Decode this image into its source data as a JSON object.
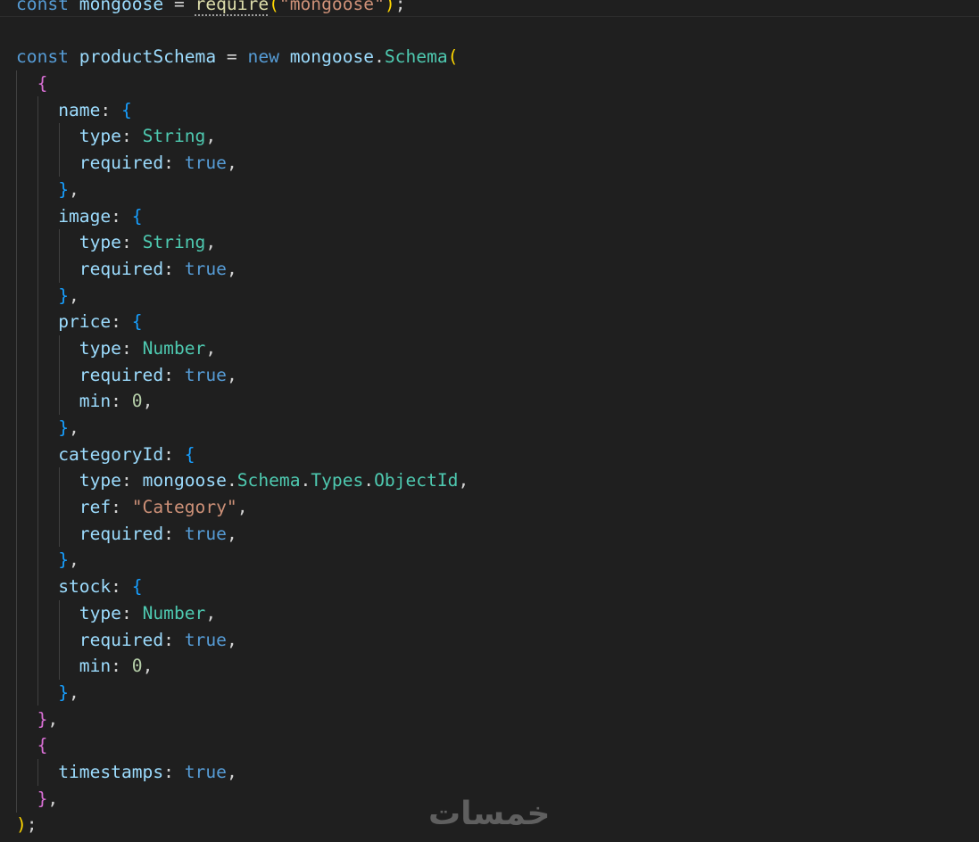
{
  "editor": {
    "lines": [
      [
        {
          "c": "kw",
          "t": "const"
        },
        {
          "c": "punc",
          "t": " "
        },
        {
          "c": "var",
          "t": "mongoose"
        },
        {
          "c": "punc",
          "t": " = "
        },
        {
          "c": "fn dotted",
          "t": "require"
        },
        {
          "c": "b1",
          "t": "("
        },
        {
          "c": "str",
          "t": "\"mongoose\""
        },
        {
          "c": "b1",
          "t": ")"
        },
        {
          "c": "punc",
          "t": ";"
        }
      ],
      [],
      [
        {
          "c": "kw",
          "t": "const"
        },
        {
          "c": "punc",
          "t": " "
        },
        {
          "c": "var",
          "t": "productSchema"
        },
        {
          "c": "punc",
          "t": " = "
        },
        {
          "c": "kw",
          "t": "new"
        },
        {
          "c": "punc",
          "t": " "
        },
        {
          "c": "var",
          "t": "mongoose"
        },
        {
          "c": "punc",
          "t": "."
        },
        {
          "c": "cls",
          "t": "Schema"
        },
        {
          "c": "b1",
          "t": "("
        }
      ],
      [
        {
          "c": "punc",
          "t": "  "
        },
        {
          "c": "b2",
          "t": "{"
        }
      ],
      [
        {
          "c": "punc",
          "t": "    "
        },
        {
          "c": "prop",
          "t": "name"
        },
        {
          "c": "punc",
          "t": ": "
        },
        {
          "c": "b3",
          "t": "{"
        }
      ],
      [
        {
          "c": "punc",
          "t": "      "
        },
        {
          "c": "prop",
          "t": "type"
        },
        {
          "c": "punc",
          "t": ": "
        },
        {
          "c": "cls",
          "t": "String"
        },
        {
          "c": "punc",
          "t": ","
        }
      ],
      [
        {
          "c": "punc",
          "t": "      "
        },
        {
          "c": "prop",
          "t": "required"
        },
        {
          "c": "punc",
          "t": ": "
        },
        {
          "c": "kw",
          "t": "true"
        },
        {
          "c": "punc",
          "t": ","
        }
      ],
      [
        {
          "c": "punc",
          "t": "    "
        },
        {
          "c": "b3",
          "t": "}"
        },
        {
          "c": "punc",
          "t": ","
        }
      ],
      [
        {
          "c": "punc",
          "t": "    "
        },
        {
          "c": "prop",
          "t": "image"
        },
        {
          "c": "punc",
          "t": ": "
        },
        {
          "c": "b3",
          "t": "{"
        }
      ],
      [
        {
          "c": "punc",
          "t": "      "
        },
        {
          "c": "prop",
          "t": "type"
        },
        {
          "c": "punc",
          "t": ": "
        },
        {
          "c": "cls",
          "t": "String"
        },
        {
          "c": "punc",
          "t": ","
        }
      ],
      [
        {
          "c": "punc",
          "t": "      "
        },
        {
          "c": "prop",
          "t": "required"
        },
        {
          "c": "punc",
          "t": ": "
        },
        {
          "c": "kw",
          "t": "true"
        },
        {
          "c": "punc",
          "t": ","
        }
      ],
      [
        {
          "c": "punc",
          "t": "    "
        },
        {
          "c": "b3",
          "t": "}"
        },
        {
          "c": "punc",
          "t": ","
        }
      ],
      [
        {
          "c": "punc",
          "t": "    "
        },
        {
          "c": "prop",
          "t": "price"
        },
        {
          "c": "punc",
          "t": ": "
        },
        {
          "c": "b3",
          "t": "{"
        }
      ],
      [
        {
          "c": "punc",
          "t": "      "
        },
        {
          "c": "prop",
          "t": "type"
        },
        {
          "c": "punc",
          "t": ": "
        },
        {
          "c": "cls",
          "t": "Number"
        },
        {
          "c": "punc",
          "t": ","
        }
      ],
      [
        {
          "c": "punc",
          "t": "      "
        },
        {
          "c": "prop",
          "t": "required"
        },
        {
          "c": "punc",
          "t": ": "
        },
        {
          "c": "kw",
          "t": "true"
        },
        {
          "c": "punc",
          "t": ","
        }
      ],
      [
        {
          "c": "punc",
          "t": "      "
        },
        {
          "c": "prop",
          "t": "min"
        },
        {
          "c": "punc",
          "t": ": "
        },
        {
          "c": "num",
          "t": "0"
        },
        {
          "c": "punc",
          "t": ","
        }
      ],
      [
        {
          "c": "punc",
          "t": "    "
        },
        {
          "c": "b3",
          "t": "}"
        },
        {
          "c": "punc",
          "t": ","
        }
      ],
      [
        {
          "c": "punc",
          "t": "    "
        },
        {
          "c": "prop",
          "t": "categoryId"
        },
        {
          "c": "punc",
          "t": ": "
        },
        {
          "c": "b3",
          "t": "{"
        }
      ],
      [
        {
          "c": "punc",
          "t": "      "
        },
        {
          "c": "prop",
          "t": "type"
        },
        {
          "c": "punc",
          "t": ": "
        },
        {
          "c": "var",
          "t": "mongoose"
        },
        {
          "c": "punc",
          "t": "."
        },
        {
          "c": "cls",
          "t": "Schema"
        },
        {
          "c": "punc",
          "t": "."
        },
        {
          "c": "cls",
          "t": "Types"
        },
        {
          "c": "punc",
          "t": "."
        },
        {
          "c": "cls",
          "t": "ObjectId"
        },
        {
          "c": "punc",
          "t": ","
        }
      ],
      [
        {
          "c": "punc",
          "t": "      "
        },
        {
          "c": "prop",
          "t": "ref"
        },
        {
          "c": "punc",
          "t": ": "
        },
        {
          "c": "str",
          "t": "\"Category\""
        },
        {
          "c": "punc",
          "t": ","
        }
      ],
      [
        {
          "c": "punc",
          "t": "      "
        },
        {
          "c": "prop",
          "t": "required"
        },
        {
          "c": "punc",
          "t": ": "
        },
        {
          "c": "kw",
          "t": "true"
        },
        {
          "c": "punc",
          "t": ","
        }
      ],
      [
        {
          "c": "punc",
          "t": "    "
        },
        {
          "c": "b3",
          "t": "}"
        },
        {
          "c": "punc",
          "t": ","
        }
      ],
      [
        {
          "c": "punc",
          "t": "    "
        },
        {
          "c": "prop",
          "t": "stock"
        },
        {
          "c": "punc",
          "t": ": "
        },
        {
          "c": "b3",
          "t": "{"
        }
      ],
      [
        {
          "c": "punc",
          "t": "      "
        },
        {
          "c": "prop",
          "t": "type"
        },
        {
          "c": "punc",
          "t": ": "
        },
        {
          "c": "cls",
          "t": "Number"
        },
        {
          "c": "punc",
          "t": ","
        }
      ],
      [
        {
          "c": "punc",
          "t": "      "
        },
        {
          "c": "prop",
          "t": "required"
        },
        {
          "c": "punc",
          "t": ": "
        },
        {
          "c": "kw",
          "t": "true"
        },
        {
          "c": "punc",
          "t": ","
        }
      ],
      [
        {
          "c": "punc",
          "t": "      "
        },
        {
          "c": "prop",
          "t": "min"
        },
        {
          "c": "punc",
          "t": ": "
        },
        {
          "c": "num",
          "t": "0"
        },
        {
          "c": "punc",
          "t": ","
        }
      ],
      [
        {
          "c": "punc",
          "t": "    "
        },
        {
          "c": "b3",
          "t": "}"
        },
        {
          "c": "punc",
          "t": ","
        }
      ],
      [
        {
          "c": "punc",
          "t": "  "
        },
        {
          "c": "b2",
          "t": "}"
        },
        {
          "c": "punc",
          "t": ","
        }
      ],
      [
        {
          "c": "punc",
          "t": "  "
        },
        {
          "c": "b2",
          "t": "{"
        }
      ],
      [
        {
          "c": "punc",
          "t": "    "
        },
        {
          "c": "prop",
          "t": "timestamps"
        },
        {
          "c": "punc",
          "t": ": "
        },
        {
          "c": "kw",
          "t": "true"
        },
        {
          "c": "punc",
          "t": ","
        }
      ],
      [
        {
          "c": "punc",
          "t": "  "
        },
        {
          "c": "b2",
          "t": "}"
        },
        {
          "c": "punc",
          "t": ","
        }
      ],
      [
        {
          "c": "b1",
          "t": ")"
        },
        {
          "c": "punc",
          "t": ";"
        }
      ]
    ]
  },
  "watermark": {
    "text": "خمسات"
  },
  "colors": {
    "background": "#1f1f1f",
    "keyword": "#569cd6",
    "variable": "#9cdcfe",
    "function": "#dcdcaa",
    "class": "#4ec9b0",
    "string": "#ce9178",
    "number": "#b5cea8",
    "bracket_1": "#ffd700",
    "bracket_2": "#da70d6",
    "bracket_3": "#179fff"
  }
}
